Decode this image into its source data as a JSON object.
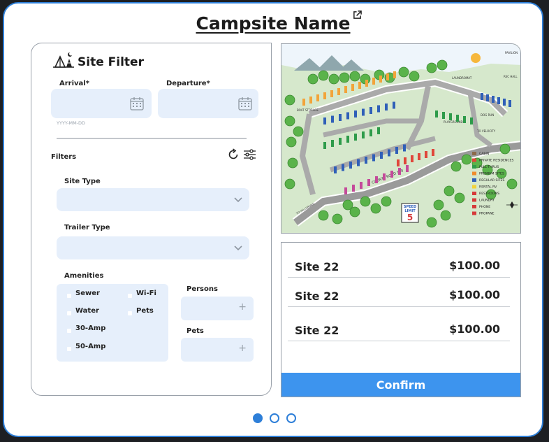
{
  "header": {
    "title": "Campsite Name",
    "external_link_icon": "external-link-icon"
  },
  "filter": {
    "heading": "Site Filter",
    "heading_icon": "campsite-tent-icon",
    "arrival_label": "Arrival*",
    "departure_label": "Departure*",
    "date_hint": "YYYY-MM-DD",
    "filters_label": "Filters",
    "site_type_label": "Site Type",
    "trailer_type_label": "Trailer Type",
    "amenities_label": "Amenities",
    "amenities": [
      "Sewer",
      "Wi-Fi",
      "Water",
      "Pets",
      "30-Amp",
      "50-Amp"
    ],
    "persons_label": "Persons",
    "pets_label": "Pets",
    "plus_symbol": "+"
  },
  "map": {
    "road_label": "COUNTY ROAD 100",
    "speed_sign": {
      "line1": "SPEED",
      "line2": "LIMIT",
      "value": "5"
    },
    "legend": [
      {
        "label": "CABIN",
        "color": "#8c6a4a"
      },
      {
        "label": "PRIVATE RESIDENCES",
        "color": "#e0463a"
      },
      {
        "label": "PULL-THRUS",
        "color": "#2e9b4a"
      },
      {
        "label": "PREMIUM SITES",
        "color": "#f08c2a"
      },
      {
        "label": "REGULAR SITES",
        "color": "#2f5fb8"
      },
      {
        "label": "RENTAL RV",
        "color": "#f2d33a"
      },
      {
        "label": "RESTROOMS",
        "color": "#d63a3a"
      },
      {
        "label": "LAUNDRY",
        "color": "#d63a3a"
      },
      {
        "label": "PHONE",
        "color": "#d63a3a"
      },
      {
        "label": "PROPANE",
        "color": "#d63a3a"
      }
    ],
    "labels": [
      "PAVILION",
      "PLAYGROUND",
      "DOG RUN",
      "TO VELOCITY",
      "BOAT STORAGE",
      "LAUNDROMAT",
      "REC HALL",
      "TO HILLSBORO"
    ]
  },
  "results": {
    "rows": [
      {
        "site": "Site 22",
        "price": "$100.00"
      },
      {
        "site": "Site 22",
        "price": "$100.00"
      },
      {
        "site": "Site 22",
        "price": "$100.00"
      }
    ],
    "confirm_label": "Confirm"
  },
  "pagination": {
    "pages": 3,
    "active_index": 0
  }
}
